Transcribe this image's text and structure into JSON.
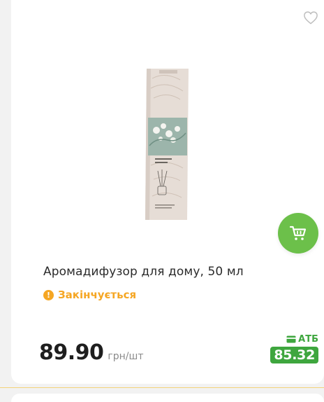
{
  "product": {
    "title": "Аромадифузор для дому, 50 мл",
    "stock_status": "Закінчується",
    "stock_icon": "exclamation-icon",
    "price": "89.90",
    "price_unit": "грн/шт",
    "club_label": "АТБ",
    "club_price": "85.32",
    "favorite_icon": "heart-outline-icon",
    "cart_icon": "cart-icon"
  },
  "colors": {
    "accent_green": "#6cc04a",
    "club_green": "#3ea63e",
    "stock_orange": "#f5a623"
  }
}
